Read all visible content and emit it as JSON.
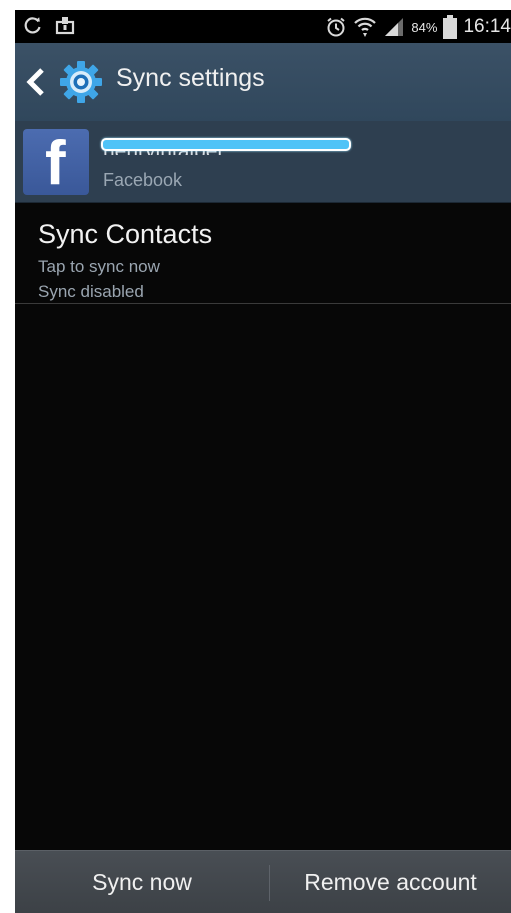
{
  "status_bar": {
    "time": "16:14",
    "battery_percent": "84%",
    "left_icons": [
      "sync-icon",
      "screenshot-icon"
    ],
    "right_icons": [
      "alarm-icon",
      "wifi-icon",
      "signal-icon",
      "battery-icon"
    ]
  },
  "action_bar": {
    "title": "Sync settings",
    "icons": [
      "back-icon",
      "settings-gear-icon"
    ]
  },
  "account": {
    "name": "henryintalper",
    "type": "Facebook",
    "logo_letter": "f",
    "name_redacted": true
  },
  "sync_item": {
    "title": "Sync Contacts",
    "subtitle": "Tap to sync now",
    "status": "Sync disabled"
  },
  "bottom_bar": {
    "sync_now": "Sync now",
    "remove_account": "Remove account"
  },
  "colors": {
    "action_bar": "#30475c",
    "account_row": "#2e3f50",
    "background": "#070707",
    "redaction": "#4fc3f7",
    "facebook": "#3b5998"
  }
}
